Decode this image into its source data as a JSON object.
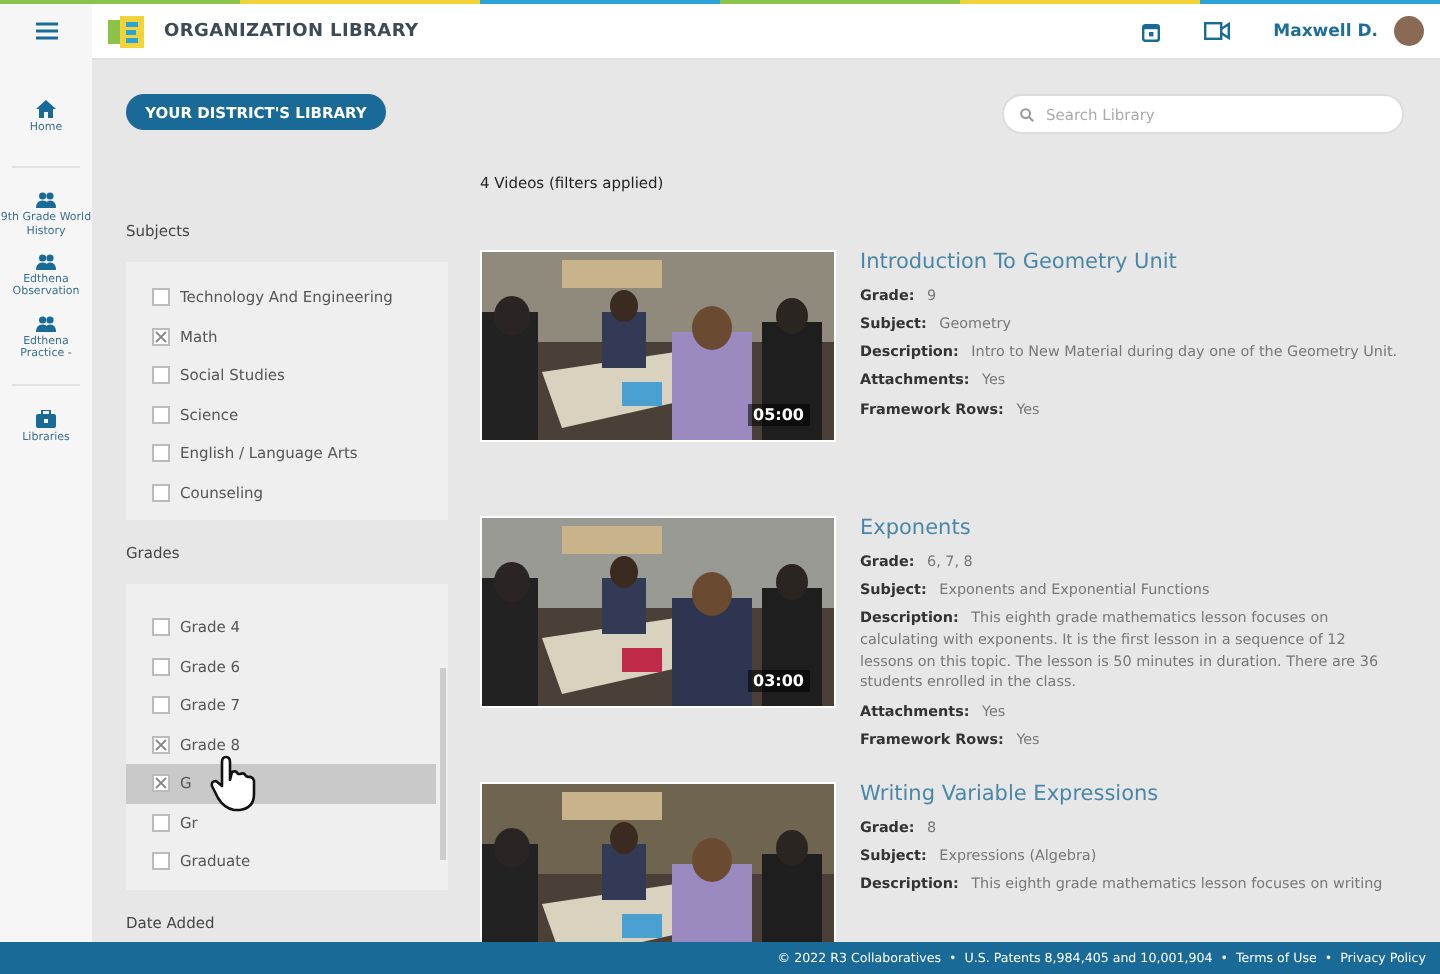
{
  "header": {
    "title": "ORGANIZATION LIBRARY",
    "user": "Maxwell D."
  },
  "nav": [
    {
      "label": "Home",
      "kind": "home"
    },
    {
      "label": "9th Grade World History",
      "kind": "group"
    },
    {
      "label": "Edthena Observation",
      "kind": "group"
    },
    {
      "label": "Edthena Practice -",
      "kind": "group"
    },
    {
      "label": "Libraries",
      "kind": "library"
    }
  ],
  "library_button": "YOUR DISTRICT'S LIBRARY",
  "search": {
    "placeholder": "Search Library"
  },
  "result_count": "4 Videos (filters applied)",
  "filters": [
    {
      "title": "Subjects",
      "options": [
        {
          "label": "Technology And Engineering",
          "checked": false,
          "hovered": false
        },
        {
          "label": "Math",
          "checked": true,
          "hovered": false
        },
        {
          "label": "Social Studies",
          "checked": false,
          "hovered": false
        },
        {
          "label": "Science",
          "checked": false,
          "hovered": false
        },
        {
          "label": "English / Language Arts",
          "checked": false,
          "hovered": false
        },
        {
          "label": "Counseling",
          "checked": false,
          "hovered": false
        }
      ]
    },
    {
      "title": "Grades",
      "options": [
        {
          "label": "Grade 4",
          "checked": false,
          "hovered": false
        },
        {
          "label": "Grade 6",
          "checked": false,
          "hovered": false
        },
        {
          "label": "Grade 7",
          "checked": false,
          "hovered": false
        },
        {
          "label": "Grade 8",
          "checked": true,
          "hovered": false
        },
        {
          "label": "G",
          "checked": true,
          "hovered": true
        },
        {
          "label": "Gr",
          "checked": false,
          "hovered": false
        },
        {
          "label": "Graduate",
          "checked": false,
          "hovered": false
        }
      ]
    },
    {
      "title": "Date Added"
    }
  ],
  "videos": [
    {
      "title": "Introduction To Geometry Unit",
      "duration": "05:00",
      "fields": [
        {
          "label": "Grade:",
          "value": "9"
        },
        {
          "label": "Subject:",
          "value": "Geometry"
        },
        {
          "label": "Description:",
          "value": "Intro to New Material during day one of the Geometry Unit."
        },
        {
          "label": "Attachments:",
          "value": "Yes"
        },
        {
          "label": "Framework Rows:",
          "value": "Yes"
        }
      ]
    },
    {
      "title": "Exponents",
      "duration": "03:00",
      "fields": [
        {
          "label": "Grade:",
          "value": "6, 7, 8"
        },
        {
          "label": "Subject:",
          "value": "Exponents and Exponential Functions"
        },
        {
          "label": "Description:",
          "value": "This eighth grade mathematics lesson focuses on calculating with exponents. It is the first lesson in a sequence of 12 lessons on this topic. The lesson is 50 minutes in duration. There are 36 students enrolled in the class."
        },
        {
          "label": "Attachments:",
          "value": "Yes"
        },
        {
          "label": "Framework Rows:",
          "value": "Yes"
        }
      ]
    },
    {
      "title": "Writing Variable Expressions",
      "fields": [
        {
          "label": "Grade:",
          "value": "8"
        },
        {
          "label": "Subject:",
          "value": "Expressions (Algebra)"
        },
        {
          "label": "Description:",
          "value": "This eighth grade mathematics lesson focuses on writing"
        }
      ]
    }
  ],
  "footer": {
    "separator": "•",
    "items": [
      "© 2022 R3 Collaboratives",
      "U.S. Patents 8,984,405 and 10,001,904",
      "Terms of Use",
      "Privacy Policy"
    ]
  }
}
